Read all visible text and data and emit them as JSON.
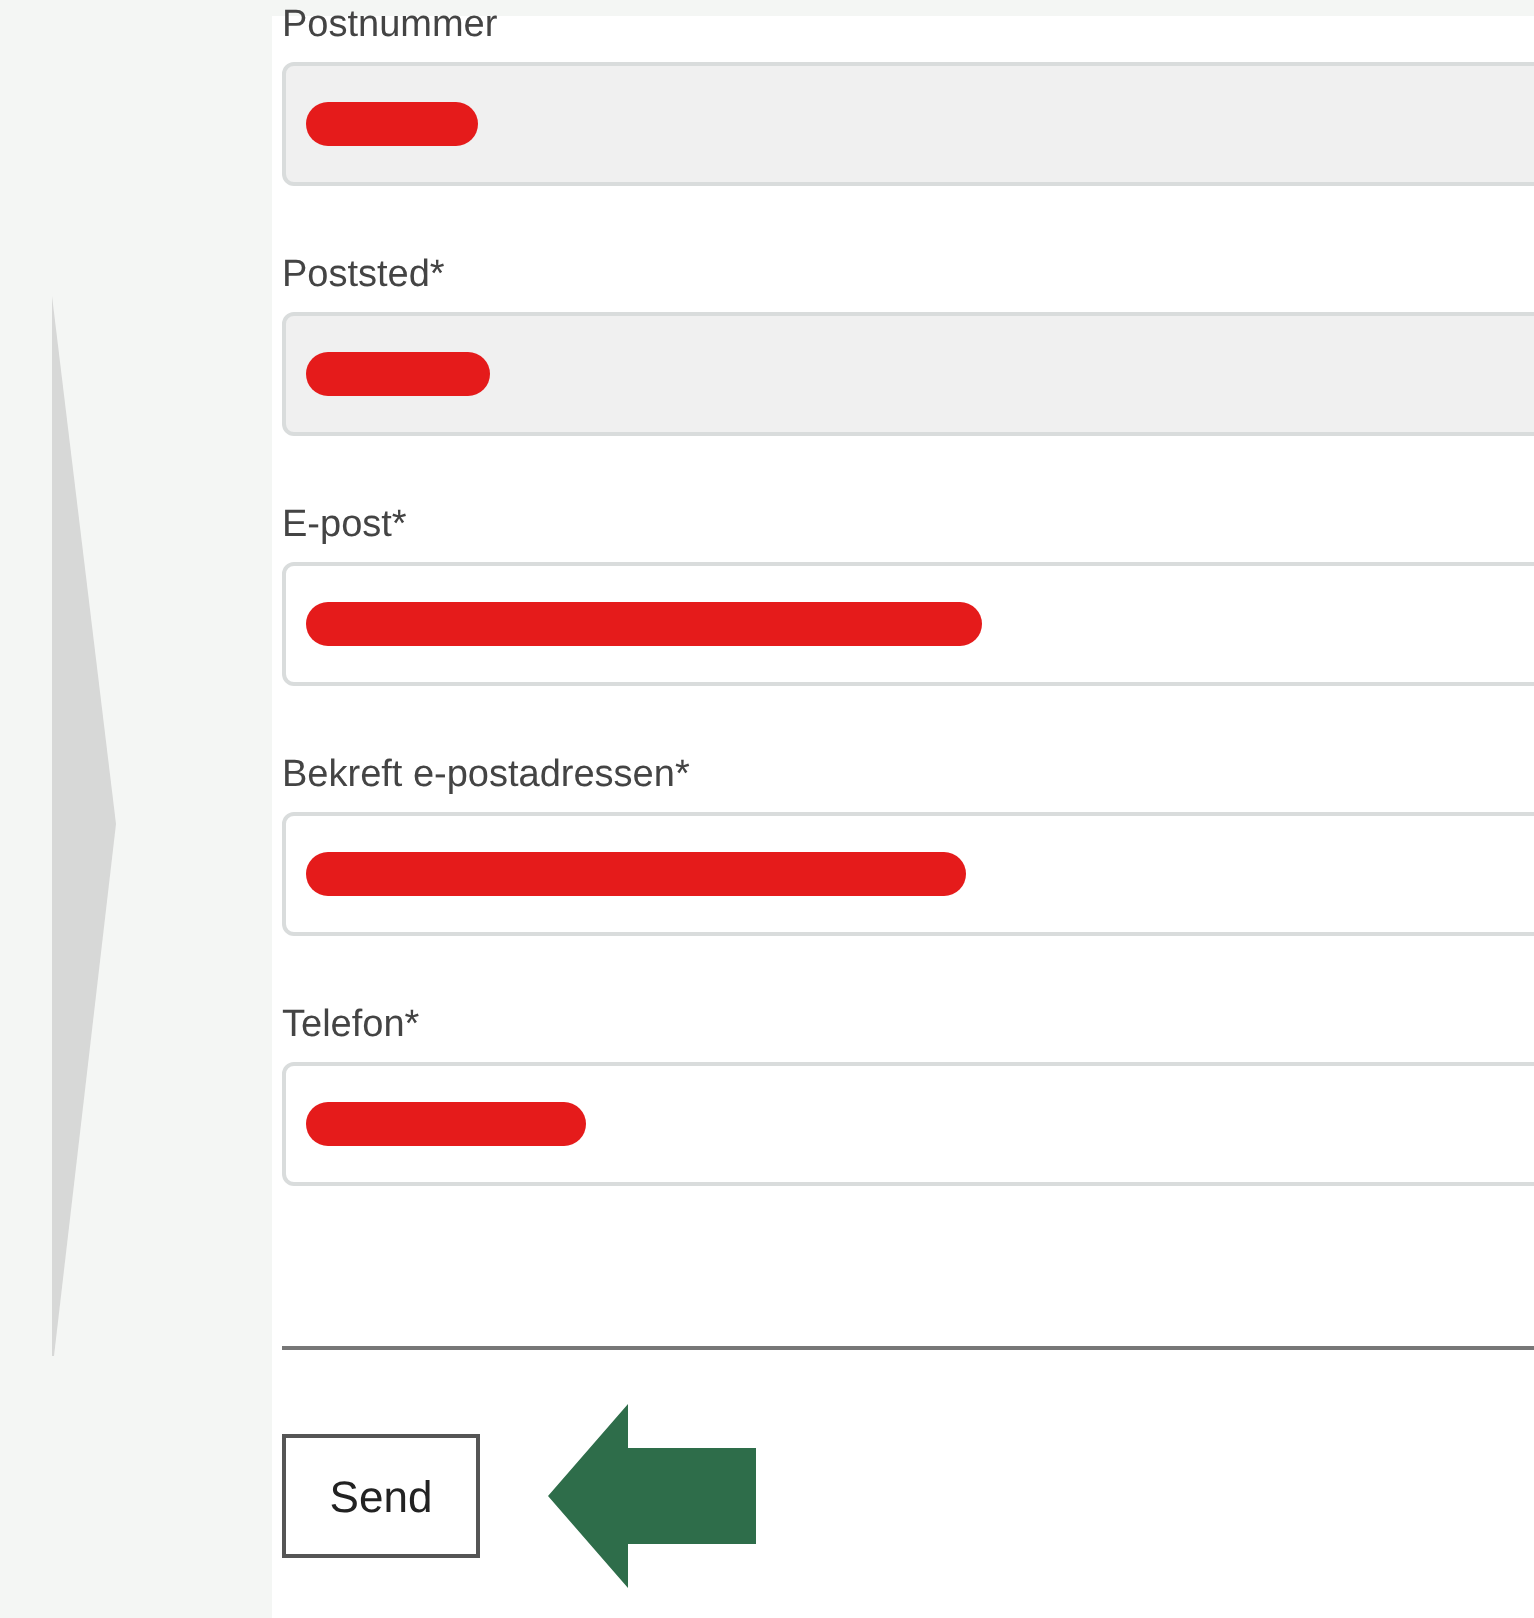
{
  "fields": [
    {
      "label": "Postnummer",
      "disabled": true,
      "redacted": true
    },
    {
      "label": "Poststed*",
      "disabled": true,
      "redacted": true
    },
    {
      "label": "E-post*",
      "disabled": false,
      "redacted": true
    },
    {
      "label": "Bekreft e-postadressen*",
      "disabled": false,
      "redacted": true
    },
    {
      "label": "Telefon*",
      "disabled": false,
      "redacted": true
    }
  ],
  "submit": {
    "label": "Send"
  }
}
